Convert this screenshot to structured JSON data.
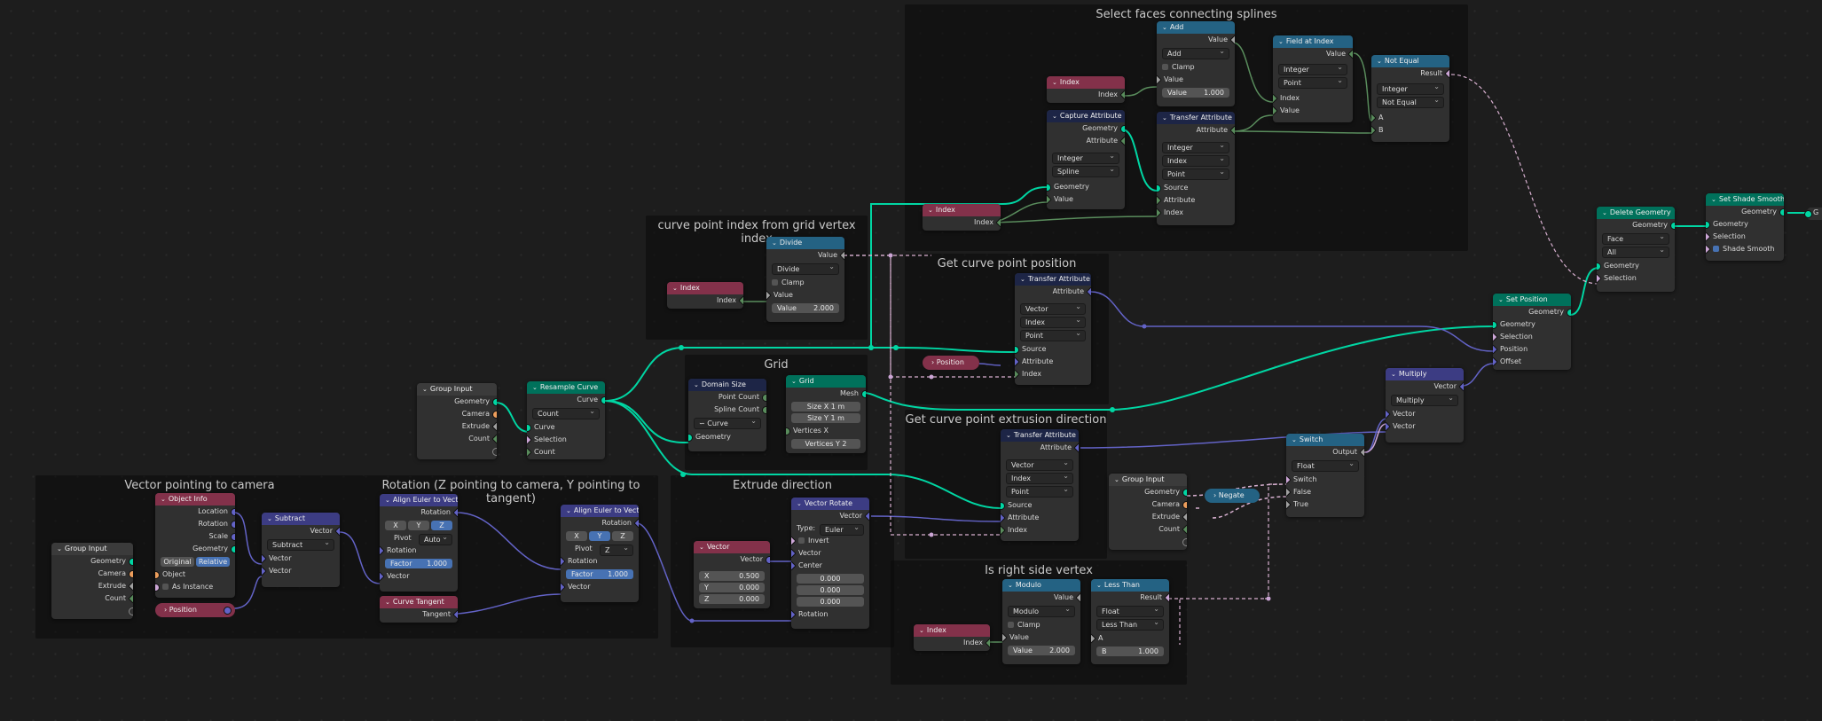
{
  "frames": {
    "vector_to_camera": "Vector pointing to camera",
    "rotation": "Rotation (Z pointing to camera, Y pointing to tangent)",
    "extrude_direction": "Extrude direction",
    "curve_point_index": "curve point index from grid vertex index",
    "grid": "Grid",
    "get_curve_pos": "Get curve point position",
    "get_curve_extrusion": "Get curve point extrusion direction",
    "select_faces": "Select faces connecting splines",
    "is_right_side": "Is right side vertex"
  },
  "nodes": {
    "group_input_a": {
      "title": "Group Input",
      "geometry": "Geometry",
      "camera": "Camera",
      "extrude": "Extrude",
      "count": "Count"
    },
    "object_info": {
      "title": "Object Info",
      "location": "Location",
      "rotation": "Rotation",
      "scale": "Scale",
      "geometry": "Geometry",
      "original": "Original",
      "relative": "Relative",
      "object": "Object",
      "as_instance": "As Instance"
    },
    "position_a": {
      "title": "Position"
    },
    "subtract": {
      "title": "Subtract",
      "vector_out": "Vector",
      "mode": "Subtract",
      "vector_a": "Vector",
      "vector_b": "Vector"
    },
    "align_a": {
      "title": "Align Euler to Vector",
      "rotation_out": "Rotation",
      "x": "X",
      "y": "Y",
      "z": "Z",
      "pivot_label": "Pivot",
      "pivot": "Auto",
      "rotation_in": "Rotation",
      "factor_label": "Factor",
      "factor": "1.000",
      "vector_in": "Vector"
    },
    "curve_tangent": {
      "title": "Curve Tangent",
      "tangent": "Tangent"
    },
    "align_b": {
      "title": "Align Euler to Vector",
      "rotation_out": "Rotation",
      "x": "X",
      "y": "Y",
      "z": "Z",
      "pivot_label": "Pivot",
      "pivot": "Z",
      "rotation_in": "Rotation",
      "factor_label": "Factor",
      "factor": "1.000",
      "vector_in": "Vector"
    },
    "group_input_b": {
      "title": "Group Input",
      "geometry": "Geometry",
      "camera": "Camera",
      "extrude": "Extrude",
      "count": "Count"
    },
    "resample": {
      "title": "Resample Curve",
      "curve_out": "Curve",
      "mode": "Count",
      "curve_in": "Curve",
      "selection": "Selection",
      "count": "Count"
    },
    "domain_size": {
      "title": "Domain Size",
      "point_count": "Point Count",
      "spline_count": "Spline Count",
      "type": "Curve",
      "geometry": "Geometry"
    },
    "grid": {
      "title": "Grid",
      "mesh": "Mesh",
      "size_x_label": "Size X",
      "size_x": "1 m",
      "size_y_label": "Size Y",
      "size_y": "1 m",
      "vertices_x": "Vertices X",
      "vertices_y_label": "Vertices Y",
      "vertices_y": "2"
    },
    "vector_node": {
      "title": "Vector",
      "vector": "Vector",
      "x_label": "X",
      "x": "0.500",
      "y_label": "Y",
      "y": "0.000",
      "z_label": "Z",
      "z": "0.000"
    },
    "vector_rotate": {
      "title": "Vector Rotate",
      "vector_out": "Vector",
      "type_label": "Type:",
      "type": "Euler",
      "invert": "Invert",
      "vector_in": "Vector",
      "center": "Center",
      "c1": "0.000",
      "c2": "0.000",
      "c3": "0.000",
      "rotation": "Rotation"
    },
    "index_a": {
      "title": "Index",
      "index": "Index"
    },
    "divide": {
      "title": "Divide",
      "value_out": "Value",
      "mode": "Divide",
      "clamp": "Clamp",
      "value_in": "Value",
      "value_label": "Value",
      "value": "2.000"
    },
    "transfer_pos": {
      "title": "Transfer Attribute",
      "attribute_out": "Attribute",
      "type": "Vector",
      "mapping": "Index",
      "domain": "Point",
      "source": "Source",
      "attribute_in": "Attribute",
      "index": "Index"
    },
    "position_b": {
      "title": "Position"
    },
    "transfer_ext": {
      "title": "Transfer Attribute",
      "attribute_out": "Attribute",
      "type": "Vector",
      "mapping": "Index",
      "domain": "Point",
      "source": "Source",
      "attribute_in": "Attribute",
      "index": "Index"
    },
    "index_b": {
      "title": "Index",
      "index": "Index"
    },
    "modulo": {
      "title": "Modulo",
      "value_out": "Value",
      "mode": "Modulo",
      "clamp": "Clamp",
      "value_in": "Value",
      "value_label": "Value",
      "value": "2.000"
    },
    "less_than": {
      "title": "Less Than",
      "result": "Result",
      "type": "Float",
      "mode": "Less Than",
      "a": "A",
      "b_label": "B",
      "b": "1.000"
    },
    "group_input_c": {
      "title": "Group Input",
      "geometry": "Geometry",
      "camera": "Camera",
      "extrude": "Extrude",
      "count": "Count"
    },
    "negate": {
      "title": "Negate"
    },
    "switch": {
      "title": "Switch",
      "output": "Output",
      "type": "Float",
      "switch": "Switch",
      "false": "False",
      "true": "True"
    },
    "multiply": {
      "title": "Multiply",
      "vector_out": "Vector",
      "mode": "Multiply",
      "vector_a": "Vector",
      "vector_b": "Vector"
    },
    "set_position": {
      "title": "Set Position",
      "geometry_out": "Geometry",
      "geometry_in": "Geometry",
      "selection": "Selection",
      "position": "Position",
      "offset": "Offset"
    },
    "index_c": {
      "title": "Index",
      "index": "Index"
    },
    "capture": {
      "title": "Capture Attribute",
      "geometry_out": "Geometry",
      "attribute_out": "Attribute",
      "type": "Integer",
      "domain": "Spline",
      "geometry_in": "Geometry",
      "value": "Value"
    },
    "index_d": {
      "title": "Index",
      "index": "Index"
    },
    "add": {
      "title": "Add",
      "value_out": "Value",
      "mode": "Add",
      "clamp": "Clamp",
      "value_in": "Value",
      "value_label": "Value",
      "value": "1.000"
    },
    "transfer_sel": {
      "title": "Transfer Attribute",
      "attribute_out": "Attribute",
      "type": "Integer",
      "mapping": "Index",
      "domain": "Point",
      "source": "Source",
      "attribute_in": "Attribute",
      "index": "Index"
    },
    "field_at_index": {
      "title": "Field at Index",
      "value_out": "Value",
      "type": "Integer",
      "domain": "Point",
      "index": "Index",
      "value_in": "Value"
    },
    "not_equal": {
      "title": "Not Equal",
      "result": "Result",
      "type": "Integer",
      "mode": "Not Equal",
      "a": "A",
      "b": "B"
    },
    "delete_geo": {
      "title": "Delete Geometry",
      "geometry_out": "Geometry",
      "domain": "Face",
      "mode": "All",
      "geometry_in": "Geometry",
      "selection": "Selection"
    },
    "set_shade": {
      "title": "Set Shade Smooth",
      "geometry_out": "Geometry",
      "geometry_in": "Geometry",
      "selection": "Selection",
      "shade_smooth": "Shade Smooth",
      "trail": "G"
    }
  },
  "colors": {
    "geometry_wire": "#00d6a3",
    "vector_wire": "#6363c7",
    "int_wire": "#598c5c",
    "field_wire": "#d8b0d0",
    "header_input": "#83314a",
    "header_geometry": "#00715b",
    "header_vector": "#3c3c83",
    "header_converter": "#246283",
    "header_attribute": "#1d2546"
  }
}
